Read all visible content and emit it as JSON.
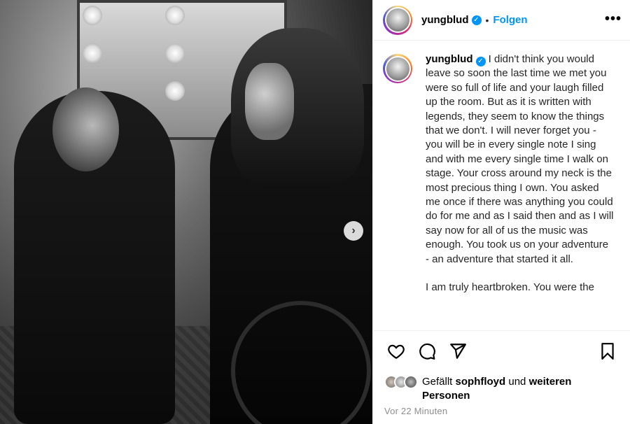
{
  "post": {
    "username": "yungblud",
    "follow_label": "Folgen",
    "separator": "•",
    "more_label": "•••",
    "next_label": "›"
  },
  "caption": {
    "username": "yungblud",
    "paragraph1": "I didn't think you would leave so soon the last time we met you were so full of life and your laugh filled up the room.  But as it is written with legends, they seem to know the things that we don't. I will never forget you - you will be in every single note I sing and with me every single time I walk on stage. Your cross around my neck is the most precious thing I own. You asked me once if there was anything you could do for me and as I said then and as I will say now for all of us the music was enough. You took us on your adventure - an adventure that started it all.",
    "paragraph2": "I am truly heartbroken. You were the"
  },
  "likes": {
    "prefix": "Gefällt",
    "user": "sophfloyd",
    "connector": "und",
    "others": "weiteren Personen"
  },
  "timestamp": "Vor 22 Minuten",
  "icons": {
    "like": "heart-icon",
    "comment": "comment-icon",
    "share": "share-icon",
    "save": "bookmark-icon",
    "verified": "verified-badge-icon",
    "next": "chevron-right-icon"
  },
  "colors": {
    "accent": "#0095f6",
    "secondary_text": "#8e8e8e"
  }
}
